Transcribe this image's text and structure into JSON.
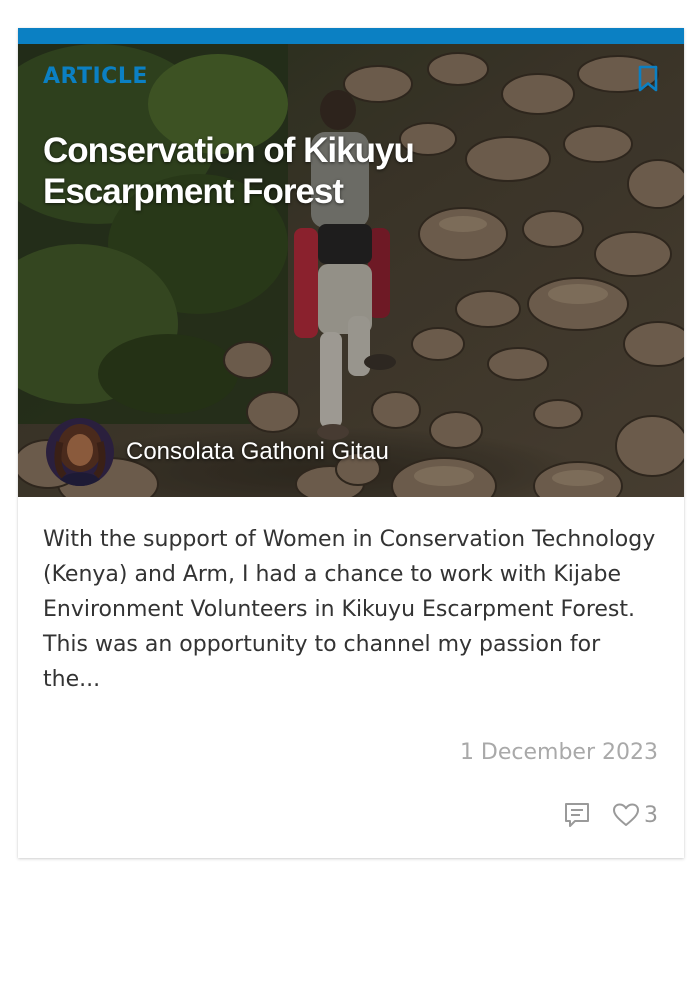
{
  "card": {
    "kicker": "ARTICLE",
    "title": "Conservation of Kikuyu Escarpment Forest",
    "author": {
      "name": "Consolata Gathoni Gitau"
    },
    "excerpt": "With the support of Women in Conservation Technology (Kenya) and Arm, I had a chance to work with Kijabe Environment Volunteers in Kikuyu Escarpment Forest. This was an opportunity to channel my passion for the...",
    "date": "1 December 2023",
    "likes": "3"
  },
  "icons": {
    "bookmark": "bookmark-icon",
    "comment": "comment-icon",
    "like": "heart-icon"
  },
  "colors": {
    "accent": "#0b80c3",
    "text": "#333333",
    "muted": "#a9a9a9"
  }
}
